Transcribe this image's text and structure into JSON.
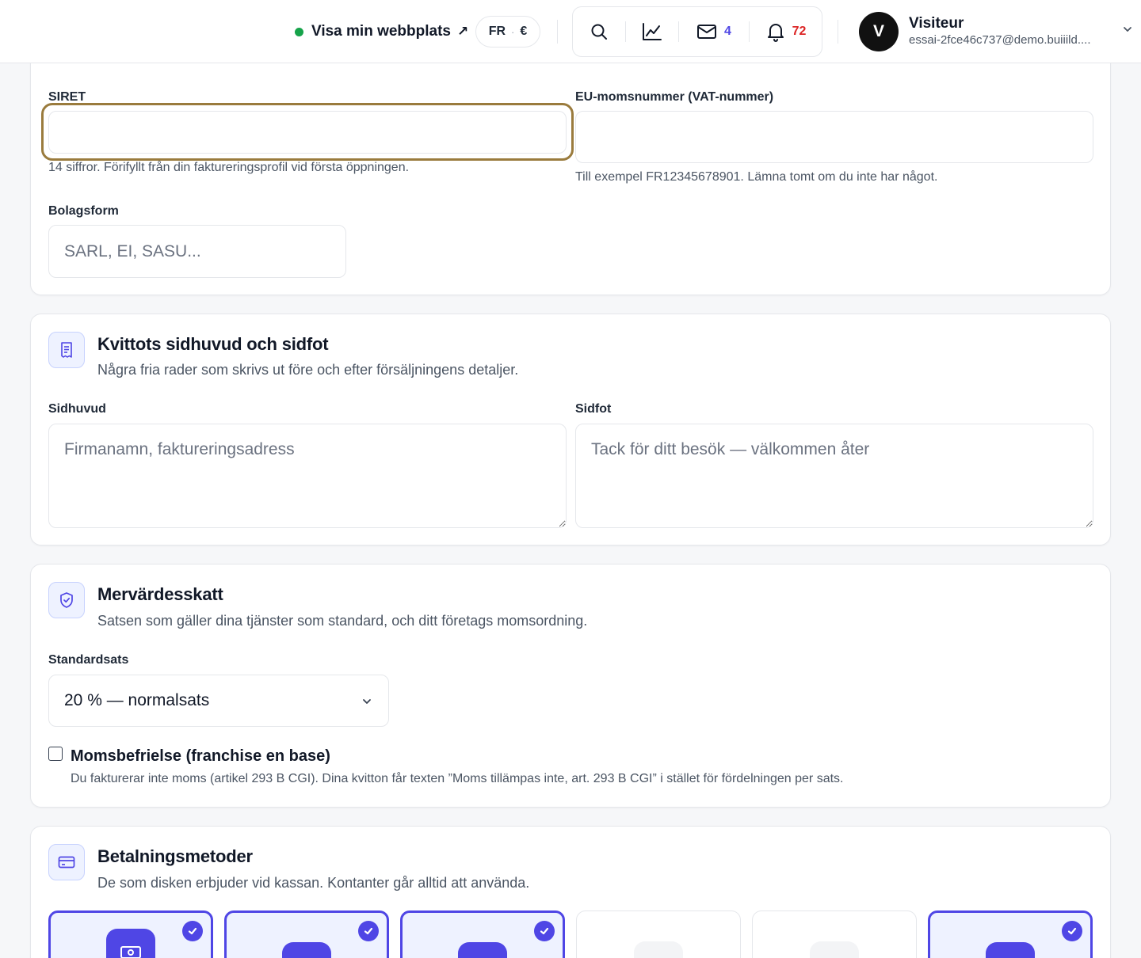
{
  "topbar": {
    "visit_site_label": "Visa min webbplats",
    "visit_site_arrow": "↗",
    "language": "FR",
    "lang_separator": "·",
    "currency": "€",
    "messages_count": "4",
    "notifications_count": "72",
    "user_initial": "V",
    "user_name": "Visiteur",
    "user_email": "essai-2fce46c737@demo.buiiild...."
  },
  "legal": {
    "siret_label": "SIRET",
    "siret_value": "",
    "siret_help": "14 siffror. Förifyllt från din faktureringsprofil vid första öppningen.",
    "vat_label": "EU-momsnummer (VAT-nummer)",
    "vat_value": "",
    "vat_help": "Till exempel FR12345678901. Lämna tomt om du inte har något.",
    "company_form_label": "Bolagsform",
    "company_form_placeholder": "SARL, EI, SASU..."
  },
  "receipt": {
    "icon": "receipt-icon",
    "title": "Kvittots sidhuvud och sidfot",
    "subtitle": "Några fria rader som skrivs ut före och efter försäljningens detaljer.",
    "header_label": "Sidhuvud",
    "header_placeholder": "Firmanamn, faktureringsadress",
    "footer_label": "Sidfot",
    "footer_placeholder": "Tack för ditt besök — välkommen åter"
  },
  "vat": {
    "icon": "shield-check-icon",
    "title": "Mervärdesskatt",
    "subtitle": "Satsen som gäller dina tjänster som standard, och ditt företags momsordning.",
    "rate_label": "Standardsats",
    "rate_selected": "20 % — normalsats",
    "exemption_label": "Momsbefrielse (franchise en base)",
    "exemption_checked": false,
    "exemption_help": "Du fakturerar inte moms (artikel 293 B CGI). Dina kvitton får texten ”Moms tillämpas inte, art. 293 B CGI” i stället för fördelningen per sats."
  },
  "payments": {
    "icon": "credit-card-icon",
    "title": "Betalningsmetoder",
    "subtitle": "De som disken erbjuder vid kassan. Kontanter går alltid att använda.",
    "tiles": [
      {
        "icon": "cash-icon",
        "selected": true
      },
      {
        "icon": "payment-method-icon",
        "selected": true
      },
      {
        "icon": "payment-method-icon",
        "selected": true
      },
      {
        "icon": "payment-method-icon",
        "selected": false
      },
      {
        "icon": "payment-method-icon",
        "selected": false
      },
      {
        "icon": "payment-method-icon",
        "selected": true
      }
    ]
  },
  "colors": {
    "accent": "#4f46e5",
    "accent_soft": "#eef2ff",
    "focus_ring": "#9a7b3d",
    "live_dot": "#16a34a",
    "notification_badge": "#dc2626"
  }
}
